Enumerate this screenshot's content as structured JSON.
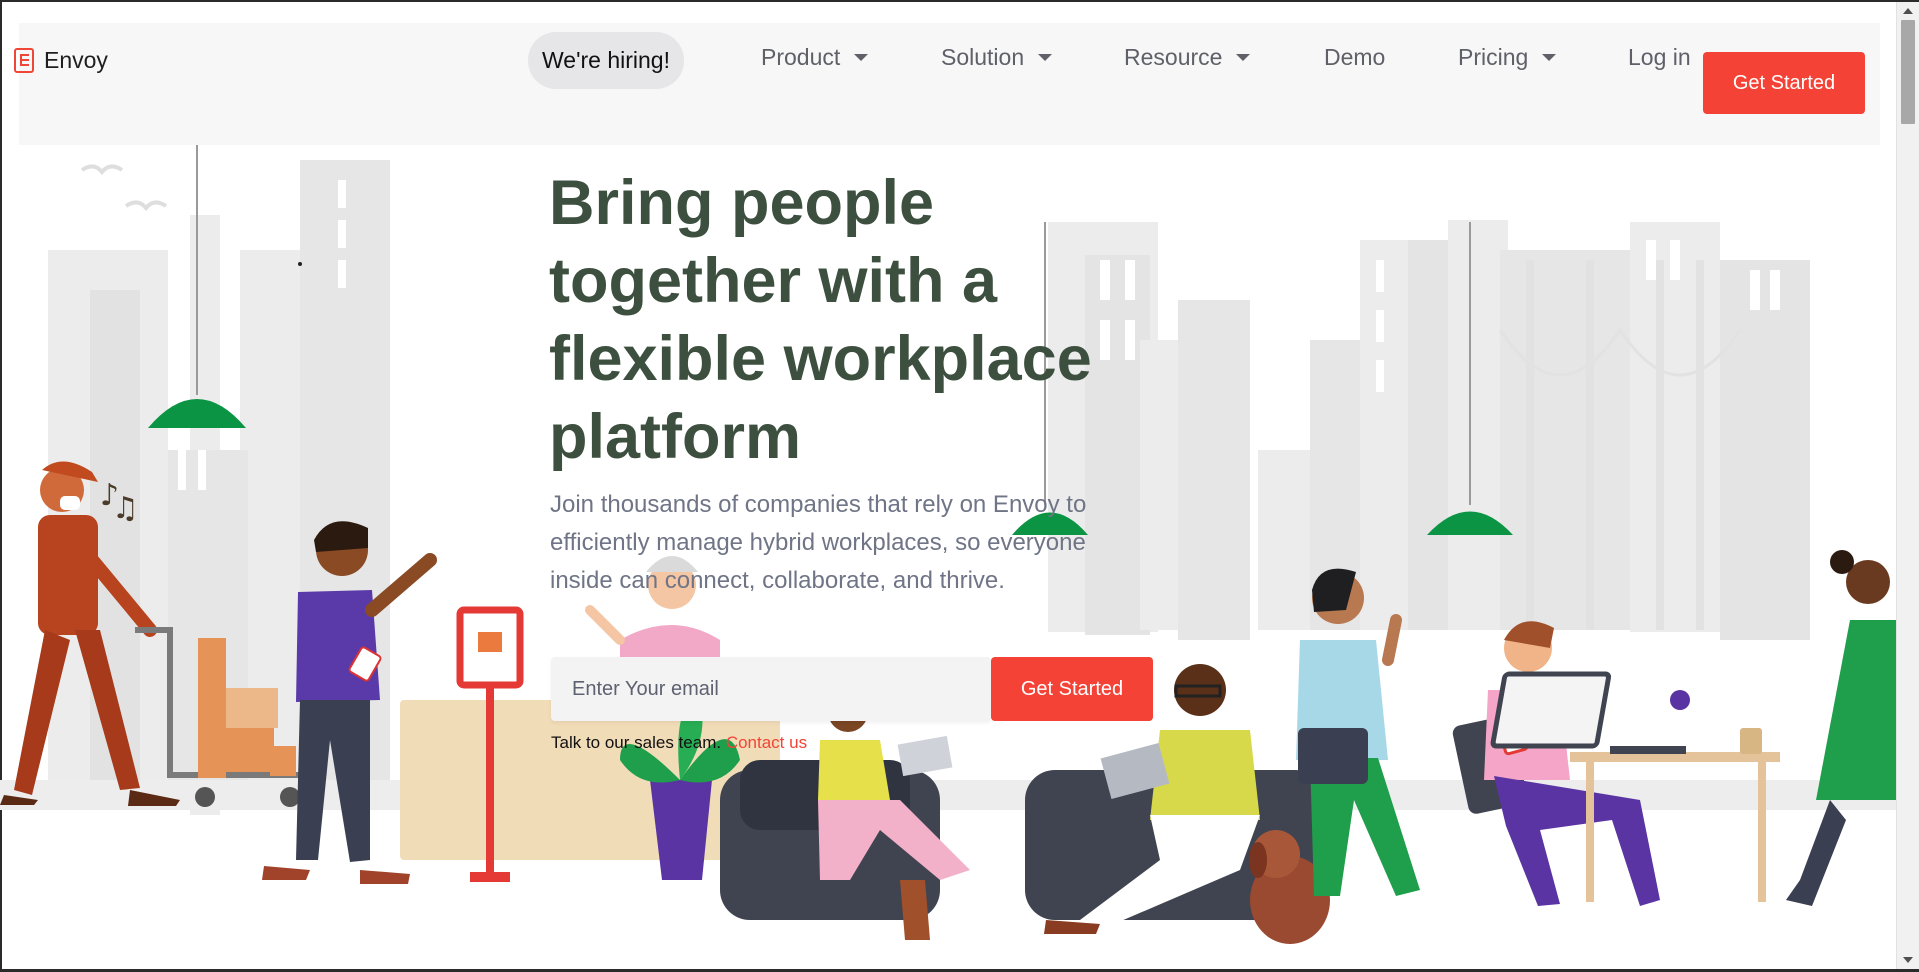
{
  "brand": {
    "name": "Envoy",
    "accent_color": "#f44336",
    "logo_icon": "envoy-logo-icon"
  },
  "nav": {
    "hiring_label": "We're hiring!",
    "items": [
      {
        "label": "Product",
        "has_dropdown": true
      },
      {
        "label": "Solution",
        "has_dropdown": true
      },
      {
        "label": "Resource",
        "has_dropdown": true
      },
      {
        "label": "Demo",
        "has_dropdown": false
      },
      {
        "label": "Pricing",
        "has_dropdown": true
      }
    ],
    "login_label": "Log in",
    "cta_label": "Get Started"
  },
  "hero": {
    "title": "Bring people together with a flexible workplace platform",
    "subtitle": "Join thousands of companies that rely on Envoy to efficiently manage hybrid workplaces, so everyone inside can connect, collaborate, and thrive.",
    "email_placeholder": "Enter Your email",
    "cta_label": "Get Started",
    "sales_text": "Talk to our sales team.",
    "sales_link": "Contact us"
  },
  "colors": {
    "headline": "#3d5040",
    "nav_bg": "#f7f7f8",
    "lamp_green": "#0a9444"
  }
}
